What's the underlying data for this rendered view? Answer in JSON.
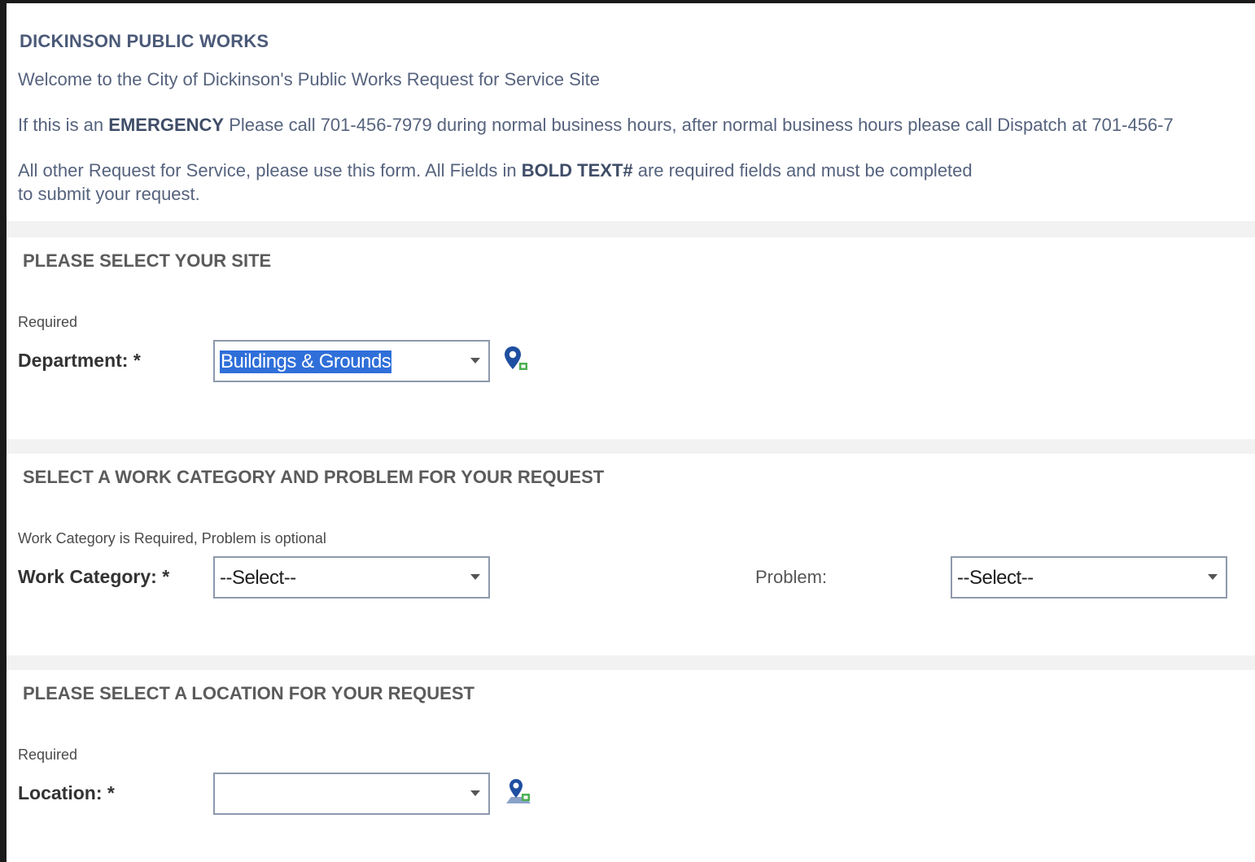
{
  "intro": {
    "title": "DICKINSON PUBLIC WORKS",
    "welcome": "Welcome to the City of Dickinson's Public Works Request for Service Site",
    "emergency_prefix": "If this is an ",
    "emergency_bold": "EMERGENCY",
    "emergency_suffix": " Please call 701-456-7979 during normal business hours, after normal business hours please call Dispatch at 701-456-7",
    "other_prefix": "All other Request for Service, please use this form. All Fields in ",
    "other_bold": "BOLD TEXT#",
    "other_suffix": " are required fields and must be completed",
    "other_line2": "to submit your request."
  },
  "site_section": {
    "title": "PLEASE SELECT YOUR SITE",
    "hint": "Required",
    "department_label": "Department: *",
    "department_value": "Buildings & Grounds",
    "map_icon": "map-pin-icon"
  },
  "category_section": {
    "title": "SELECT A WORK CATEGORY AND PROBLEM FOR YOUR REQUEST",
    "hint": "Work Category is Required, Problem is optional",
    "work_category_label": "Work Category: *",
    "work_category_value": "--Select--",
    "problem_label": "Problem:",
    "problem_value": "--Select--"
  },
  "location_section": {
    "title": "PLEASE SELECT A LOCATION FOR YOUR REQUEST",
    "hint": "Required",
    "location_label": "Location: *",
    "location_value": "",
    "map_icon": "map-location-icon"
  },
  "colors": {
    "accent_text": "#4b5a78",
    "selection_highlight": "#2f6fd9",
    "pin_blue": "#1f4fa0",
    "pin_badge_green": "#4caf50",
    "section_gap": "#f2f2f2"
  }
}
